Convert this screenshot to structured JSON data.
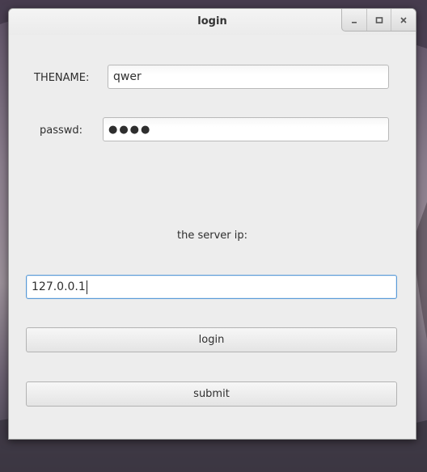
{
  "window": {
    "title": "login",
    "controls": [
      "minimize-icon",
      "maximize-icon",
      "close-icon"
    ]
  },
  "form": {
    "name_label": "THENAME:",
    "name_value": "qwer",
    "password_label": "passwd:",
    "password_value": "●●●●",
    "server_ip_label": "the server ip:",
    "server_ip_value": "127.0.0.1",
    "login_button": "login",
    "submit_button": "submit"
  },
  "colors": {
    "focus_border": "#5a9bd8",
    "window_bg": "#ededed"
  }
}
